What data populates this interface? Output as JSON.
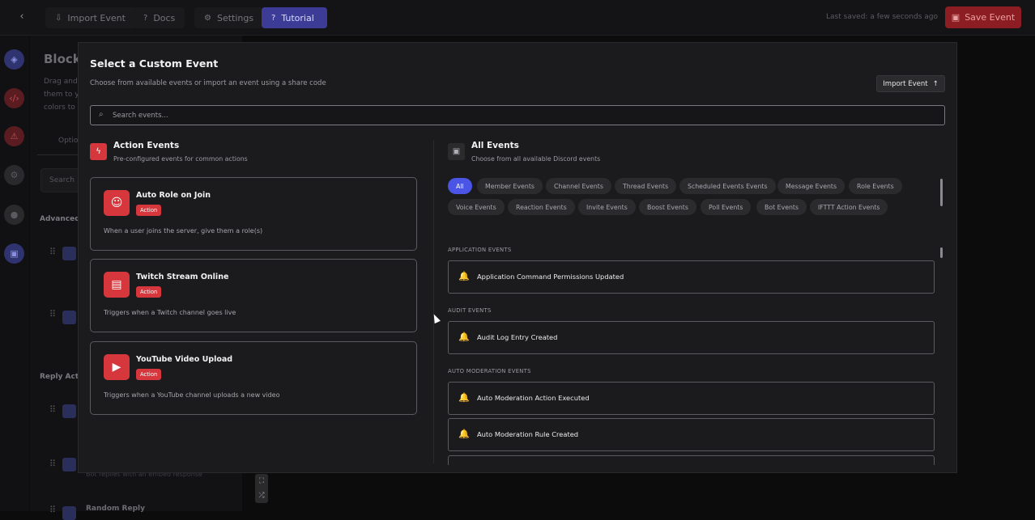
{
  "topbar": {
    "tabs": [
      {
        "label": "Import Event",
        "icon": "import-icon"
      },
      {
        "label": "Docs",
        "icon": "help-icon"
      },
      {
        "label": "Settings",
        "icon": "gear-icon"
      },
      {
        "label": "Tutorial",
        "icon": "help-icon"
      }
    ],
    "last_saved": "Last saved: a few seconds ago",
    "save_label": "Save Event"
  },
  "background": {
    "title": "Block",
    "desc_lines": [
      "Drag and",
      "them to y",
      "colors to"
    ],
    "tab": "Optio",
    "search": "Search",
    "sections": [
      "Advanced",
      "Reply Actio",
      "Random Reply"
    ],
    "faint_note": "Bot replies with an embed response"
  },
  "modal": {
    "title": "Select a Custom Event",
    "subtitle": "Choose from available events or import an event using a share code",
    "import_label": "Import Event",
    "search_placeholder": "Search events...",
    "action_section": {
      "title": "Action Events",
      "subtitle": "Pre-configured events for common actions",
      "cards": [
        {
          "title": "Auto Role on Join",
          "badge": "Action",
          "desc": "When a user joins the server, give them a role(s)",
          "icon": "masks-icon"
        },
        {
          "title": "Twitch Stream Online",
          "badge": "Action",
          "desc": "Triggers when a Twitch channel goes live",
          "icon": "twitch-icon"
        },
        {
          "title": "YouTube Video Upload",
          "badge": "Action",
          "desc": "Triggers when a YouTube channel uploads a new video",
          "icon": "youtube-icon"
        }
      ]
    },
    "all_section": {
      "title": "All Events",
      "subtitle": "Choose from all available Discord events",
      "chips_row1": [
        "All",
        "Member Events",
        "Channel Events",
        "Thread Events",
        "Scheduled Events Events",
        "Message Events",
        "Role Events"
      ],
      "chips_row2": [
        "Voice Events",
        "Reaction Events",
        "Invite Events",
        "Boost Events",
        "Poll Events",
        "Bot Events",
        "IFTTT Action Events"
      ],
      "categories": [
        {
          "label": "APPLICATION EVENTS",
          "events": [
            "Application Command Permissions Updated"
          ]
        },
        {
          "label": "AUDIT EVENTS",
          "events": [
            "Audit Log Entry Created"
          ]
        },
        {
          "label": "AUTO MODERATION EVENTS",
          "events": [
            "Auto Moderation Action Executed",
            "Auto Moderation Rule Created"
          ]
        }
      ]
    }
  },
  "colors": {
    "accent": "#4a55e6",
    "danger": "#d6373c",
    "bell": "#f1b73a"
  }
}
